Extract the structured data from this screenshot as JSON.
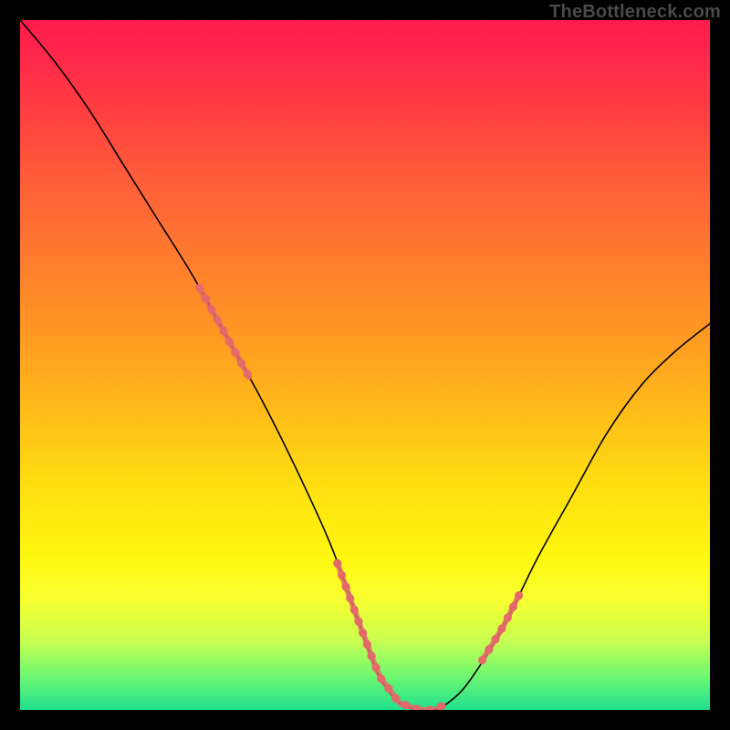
{
  "watermark": "TheBottleneck.com",
  "chart_data": {
    "type": "line",
    "title": "",
    "xlabel": "",
    "ylabel": "",
    "xlim": [
      0,
      100
    ],
    "ylim": [
      0,
      100
    ],
    "x": [
      0,
      5,
      10,
      15,
      20,
      25,
      30,
      35,
      40,
      45,
      49,
      52,
      55,
      58,
      60,
      62,
      65,
      70,
      75,
      80,
      85,
      90,
      95,
      100
    ],
    "values": [
      100,
      94,
      87,
      79,
      71,
      63,
      54,
      45,
      35,
      24,
      13,
      5,
      1,
      0,
      0,
      1,
      4,
      12,
      22,
      31,
      40,
      47,
      52,
      56
    ],
    "highlight_segments": [
      {
        "x_start": 26,
        "x_end": 34
      },
      {
        "x_start": 46,
        "x_end": 62
      },
      {
        "x_start": 67,
        "x_end": 73
      }
    ],
    "colors": {
      "curve": "#000000",
      "highlight": "#e46a6a",
      "background_top": "#ff1a4d",
      "background_bottom": "#20e090"
    }
  }
}
